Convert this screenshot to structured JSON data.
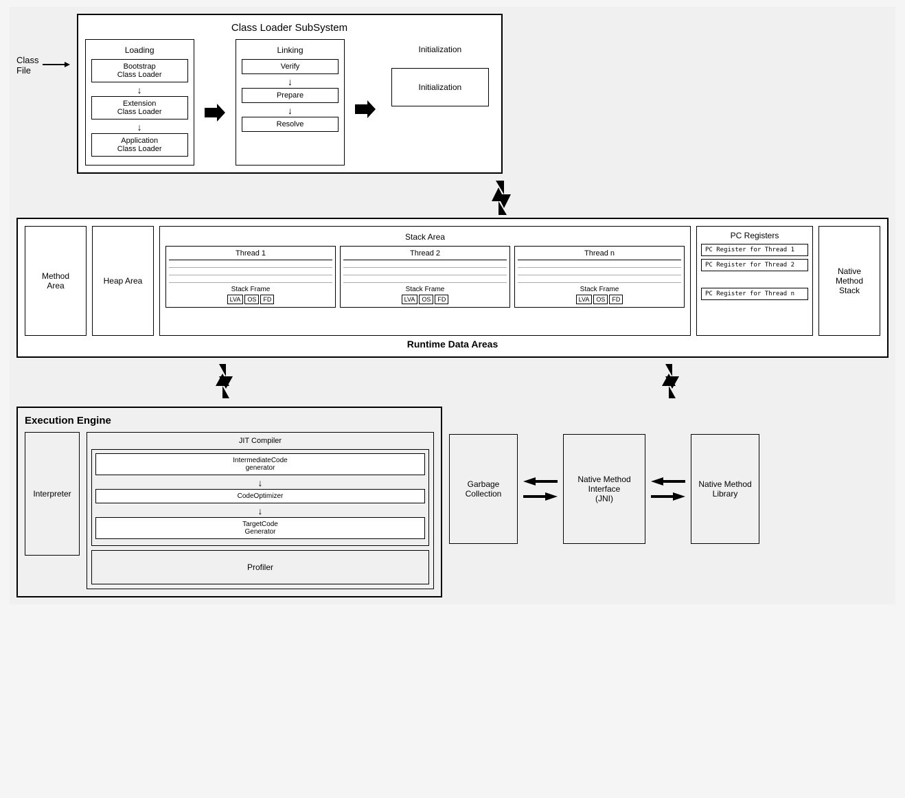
{
  "classLoaderSubSystem": {
    "title": "Class Loader SubSystem",
    "classFileLabel": "Class\nFile",
    "loading": {
      "title": "Loading",
      "bootstrap": "Bootstrap\nClass Loader",
      "extension": "Extension\nClass Loader",
      "application": "Application\nClass Loader"
    },
    "linking": {
      "title": "Linking",
      "verify": "Verify",
      "prepare": "Prepare",
      "resolve": "Resolve"
    },
    "initialization": {
      "title": "Initialization",
      "box": "Initialization"
    }
  },
  "runtimeDataAreas": {
    "title": "Runtime Data Areas",
    "methodArea": "Method\nArea",
    "heapArea": "Heap Area",
    "stackArea": {
      "title": "Stack Area",
      "thread1": "Thread 1",
      "thread2": "Thread 2",
      "threadN": "Thread n",
      "stackFrameLabel": "Stack Frame",
      "lva": "LVA",
      "os": "OS",
      "fd": "FD"
    },
    "pcRegisters": {
      "title": "PC Registers",
      "reg1": "PC Register for Thread 1",
      "reg2": "PC Register for Thread 2",
      "regN": "PC Register for Thread n"
    },
    "nativeMethodStack": "Native\nMethod\nStack"
  },
  "executionEngine": {
    "title": "Execution Engine",
    "interpreter": "Interpreter",
    "jitCompiler": {
      "title": "JIT Compiler",
      "intermediateCode": "IntermediateCode\ngenerator",
      "codeOptimizer": "CodeOptimizer",
      "targetCode": "TargetCode\nGenerator"
    },
    "profiler": "Profiler",
    "garbageCollection": "Garbage\nCollection",
    "nativeMethodInterface": "Native Method\nInterface\n(JNI)",
    "nativeMethodLibrary": "Native Method\nLibrary"
  }
}
